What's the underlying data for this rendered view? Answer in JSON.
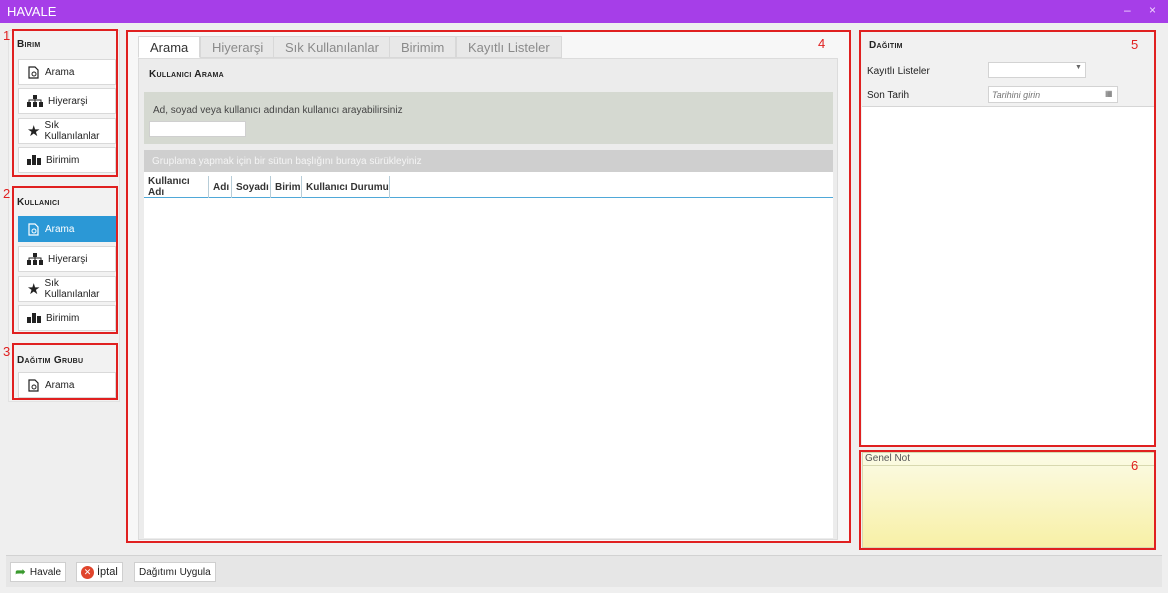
{
  "window": {
    "title": "HAVALE",
    "minimize": "–",
    "close": "×"
  },
  "annotations": [
    "1",
    "2",
    "3",
    "4",
    "5",
    "6"
  ],
  "birim": {
    "title": "Birim",
    "items": [
      {
        "label": "Arama"
      },
      {
        "label": "Hiyerarşi"
      },
      {
        "label": "Sık Kullanılanlar"
      },
      {
        "label": "Birimim"
      }
    ]
  },
  "kullanici": {
    "title": "Kullanıcı",
    "items": [
      {
        "label": "Arama"
      },
      {
        "label": "Hiyerarşi"
      },
      {
        "label": "Sık Kullanılanlar"
      },
      {
        "label": "Birimim"
      }
    ]
  },
  "dagitim_grubu": {
    "title": "Dağıtım Grubu",
    "items": [
      {
        "label": "Arama"
      }
    ]
  },
  "tabs": [
    "Arama",
    "Hiyerarşi",
    "Sık Kullanılanlar",
    "Birimim",
    "Kayıtlı Listeler"
  ],
  "search": {
    "heading": "Kullanıcı Arama",
    "hint": "Ad, soyad veya kullanıcı adından kullanıcı arayabilirsiniz",
    "value": ""
  },
  "grid": {
    "group_hint": "Gruplama yapmak için bir sütun başlığını buraya sürükleyiniz",
    "columns": [
      "Kullanıcı Adı",
      "Adı",
      "Soyadı",
      "Birim",
      "Kullanıcı Durumu"
    ]
  },
  "dagitim": {
    "title": "Dağıtım",
    "kayitli_label": "Kayıtlı Listeler",
    "kayitli_value": "",
    "son_tarih_label": "Son Tarih",
    "son_tarih_placeholder": "Tarihini girin"
  },
  "genel_not": {
    "label": "Genel Not",
    "value": ""
  },
  "footer": {
    "havale": "Havale",
    "iptal": "İptal",
    "uygula": "Dağıtımı Uygula"
  },
  "colors": {
    "titlebar": "#a63ee8",
    "active": "#2b98d6",
    "annotation": "#e02020",
    "note": "#fbf8c0"
  }
}
